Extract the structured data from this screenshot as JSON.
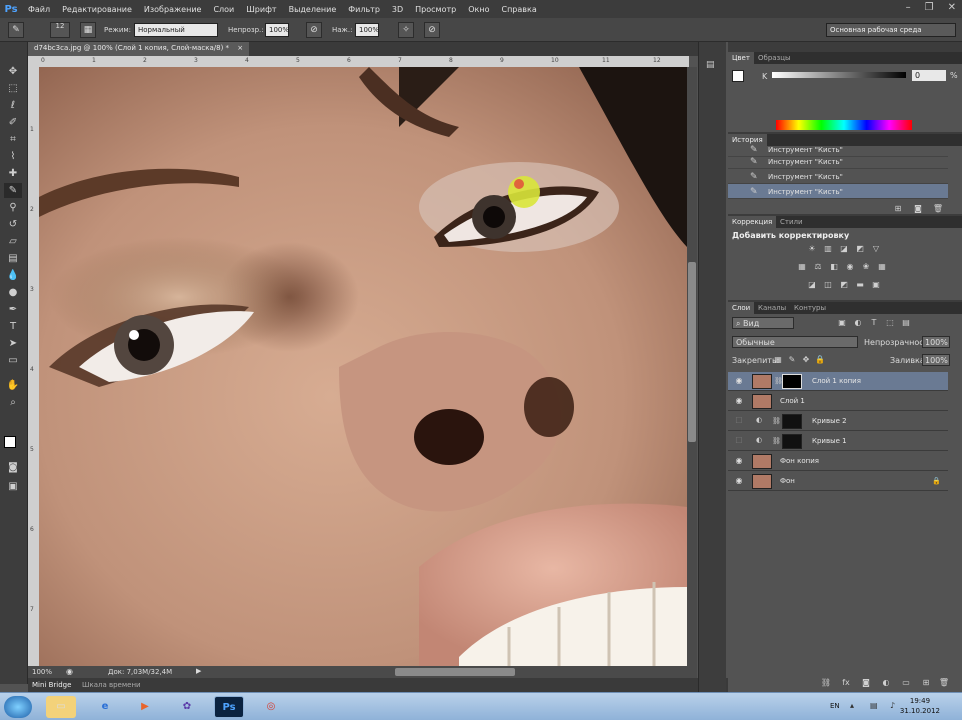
{
  "app": {
    "logo": "Ps"
  },
  "menu": [
    "Файл",
    "Редактирование",
    "Изображение",
    "Слои",
    "Шрифт",
    "Выделение",
    "Фильтр",
    "3D",
    "Просмотр",
    "Окно",
    "Справка"
  ],
  "window_controls": {
    "minimize": "–",
    "restore": "❐",
    "close": "✕"
  },
  "options": {
    "brush_size": "12",
    "mode_label": "Режим:",
    "mode_value": "Нормальный",
    "opacity_label": "Непрозр.:",
    "opacity_value": "100%",
    "pressure_label": "Наж.:",
    "pressure_value": "100%",
    "workspace": "Основная рабочая среда"
  },
  "document": {
    "tab_title": "d74bc3ca.jpg @ 100% (Слой 1 копия, Слой-маска/8) *",
    "tab_close": "×",
    "ruler_h_ticks": [
      "0",
      "1",
      "2",
      "3",
      "4",
      "5",
      "6",
      "7",
      "8",
      "9",
      "10",
      "11",
      "12"
    ],
    "ruler_v_ticks": [
      "1",
      "2",
      "3",
      "4",
      "5",
      "6",
      "7"
    ]
  },
  "status": {
    "zoom": "100%",
    "doc_size": "Док: 7,03M/32,4M"
  },
  "bottom_tabs": [
    "Mini Bridge",
    "Шкала времени"
  ],
  "color_panel": {
    "tabs": [
      "Цвет",
      "Образцы"
    ],
    "channel_label": "K",
    "channel_value": "0",
    "unit": "%"
  },
  "history_panel": {
    "tab": "История",
    "items": [
      "Инструмент \"Кисть\"",
      "Инструмент \"Кисть\"",
      "Инструмент \"Кисть\"",
      "Инструмент \"Кисть\""
    ]
  },
  "adjustments_panel": {
    "tabs": [
      "Коррекция",
      "Стили"
    ],
    "title": "Добавить корректировку"
  },
  "layers_panel": {
    "tabs": [
      "Слои",
      "Каналы",
      "Контуры"
    ],
    "filter_label": "Вид",
    "blend_mode": "Обычные",
    "opacity_label": "Непрозрачность:",
    "opacity_value": "100%",
    "lock_label": "Закрепить:",
    "fill_label": "Заливка:",
    "fill_value": "100%",
    "layers": [
      {
        "name": "Слой 1 копия",
        "selected": true
      },
      {
        "name": "Слой 1",
        "selected": false
      },
      {
        "name": "Кривые 2",
        "selected": false
      },
      {
        "name": "Кривые 1",
        "selected": false
      },
      {
        "name": "Фон копия",
        "selected": false
      },
      {
        "name": "Фон",
        "selected": false
      }
    ]
  },
  "taskbar": {
    "lang": "EN",
    "time": "19:49",
    "date": "31.10.2012",
    "ps_label": "Ps"
  },
  "colors": {
    "accent": "#2d5fa8",
    "background": "#535353",
    "menubar": "#3c3c3c"
  }
}
